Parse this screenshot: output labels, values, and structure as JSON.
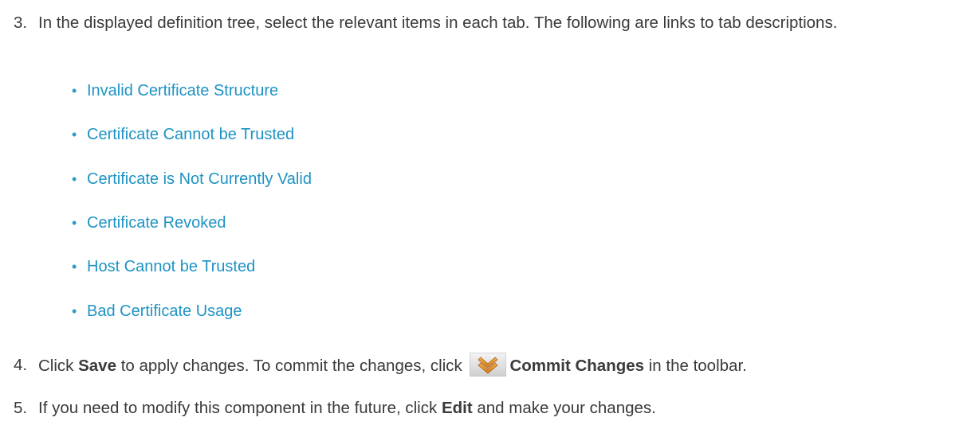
{
  "step3": {
    "number": "3.",
    "text": "In the displayed definition tree, select the relevant items in each tab. The following are links to tab descriptions."
  },
  "links": [
    {
      "label": "Invalid Certificate Structure"
    },
    {
      "label": "Certificate Cannot be Trusted"
    },
    {
      "label": "Certificate is Not Currently Valid"
    },
    {
      "label": "Certificate Revoked"
    },
    {
      "label": "Host Cannot be Trusted"
    },
    {
      "label": "Bad Certificate Usage"
    }
  ],
  "bullet_char": "•",
  "step4": {
    "number": "4.",
    "text_before": "Click ",
    "save": "Save",
    "text_middle": " to apply changes. To commit the changes, click ",
    "commit_icon": "commit-changes-icon",
    "commit": "Commit Changes",
    "text_after": " in the toolbar."
  },
  "step5": {
    "number": "5.",
    "text_before": "If you need to modify this component in the future, click ",
    "edit": "Edit",
    "text_after": " and make your changes."
  },
  "colors": {
    "text": "#3a3a3a",
    "link": "#1e93c4"
  }
}
